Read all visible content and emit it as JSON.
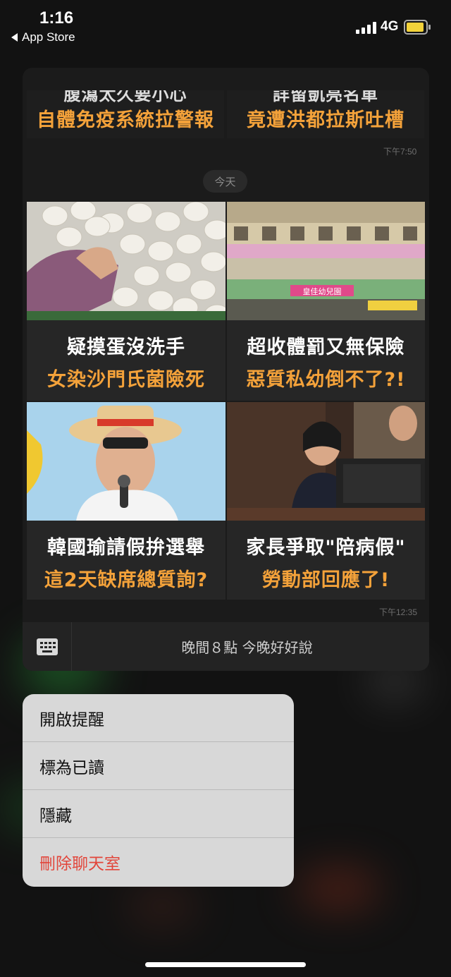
{
  "status_bar": {
    "time": "1:16",
    "back_label": "App Store",
    "network": "4G",
    "battery_color": "#f2d23a"
  },
  "chat": {
    "prev_tiles": [
      {
        "line1": "腹瀉太久要小心",
        "line2": "自體免疫系統拉警報"
      },
      {
        "line1": "詳留凱亮名單",
        "line2": "竟遭洪都拉斯吐槽"
      }
    ],
    "prev_time": "下午7:50",
    "date_divider": "今天",
    "tiles": [
      {
        "line1": "疑摸蛋沒洗手",
        "line2": "女染沙門氏菌險死"
      },
      {
        "line1": "超收體罰又無保險",
        "line2": "惡質私幼倒不了?!"
      },
      {
        "line1": "韓國瑜請假拚選舉",
        "line2": "這2天缺席總質詢?"
      },
      {
        "line1": "家長爭取\"陪病假\"",
        "line2": "勞動部回應了!"
      }
    ],
    "kindergarten_sign": "皇佳幼兒園",
    "latest_time": "下午12:35",
    "input_text": "晚間８點 今晚好好說"
  },
  "menu": {
    "items": [
      {
        "label": "開啟提醒"
      },
      {
        "label": "標為已讀"
      },
      {
        "label": "隱藏"
      },
      {
        "label": "刪除聊天室"
      }
    ],
    "danger_color": "#e2463b"
  }
}
